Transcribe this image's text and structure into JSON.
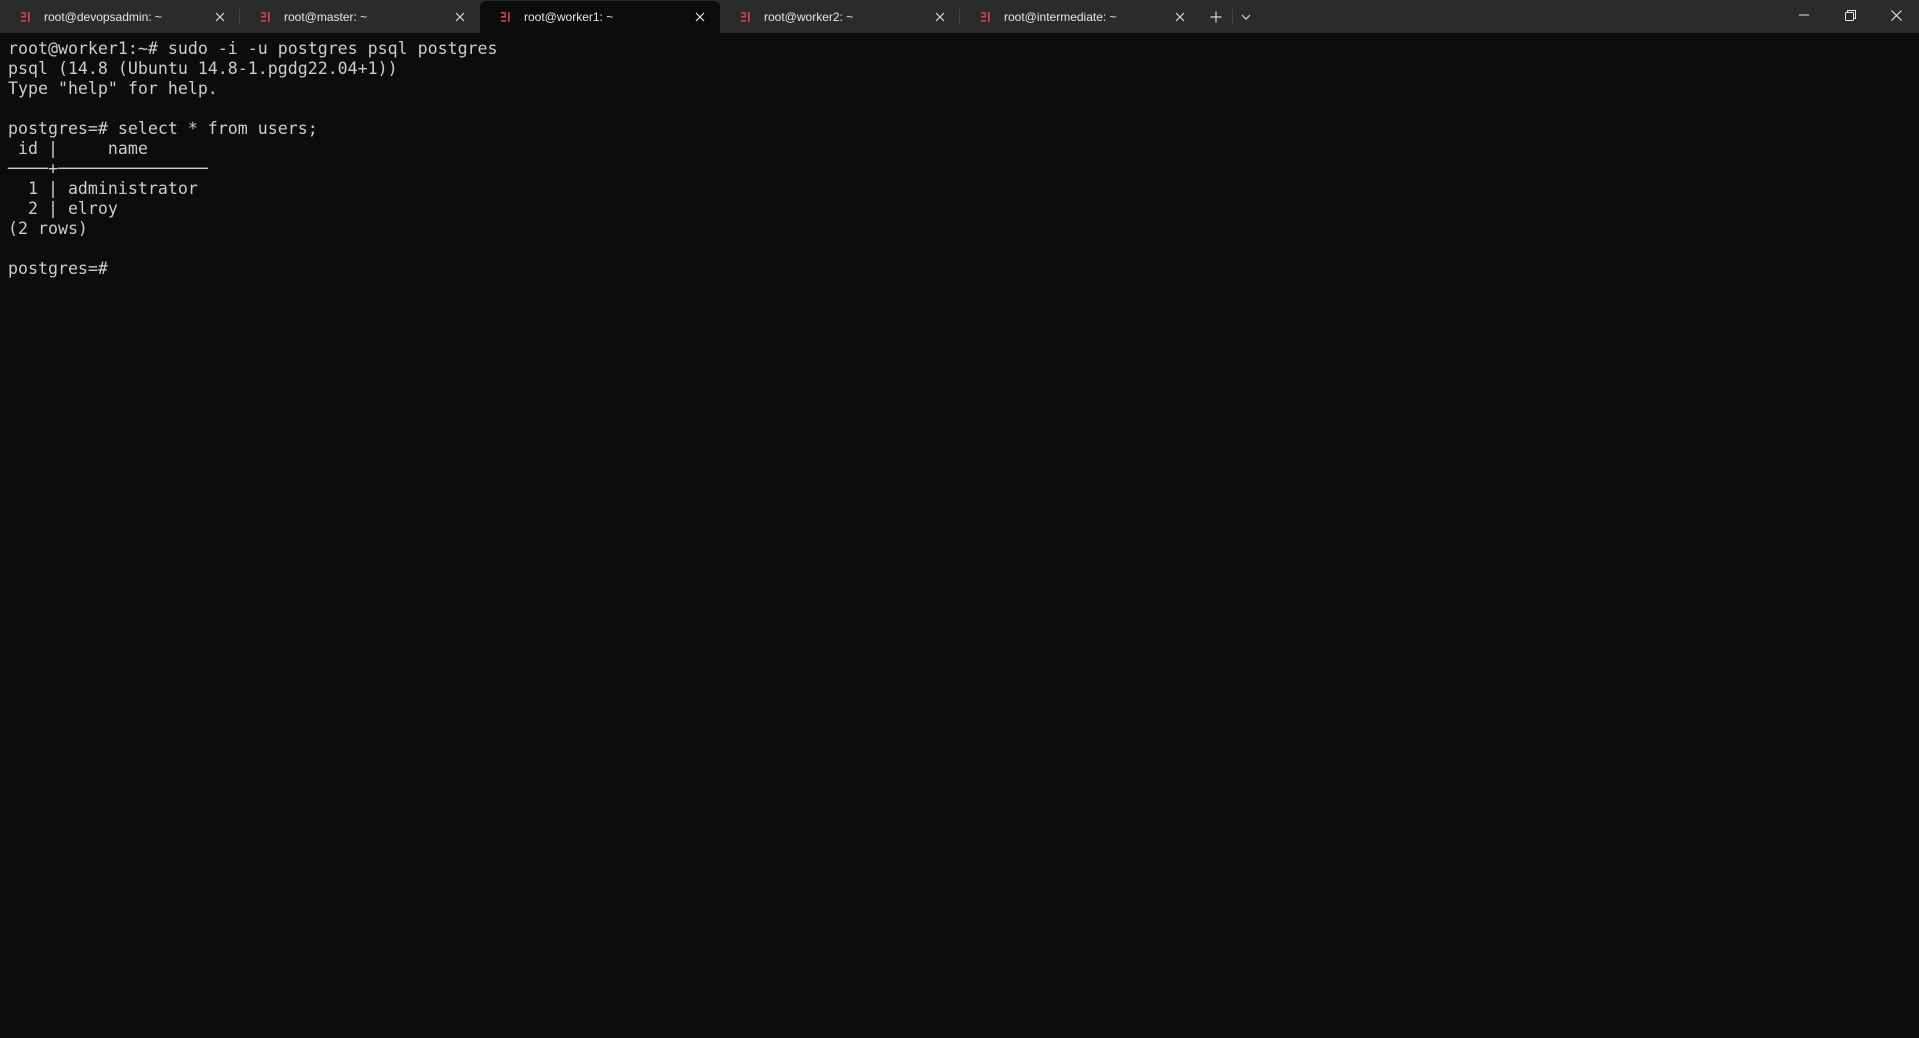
{
  "tabs": [
    {
      "title": "root@devopsadmin: ~",
      "active": false
    },
    {
      "title": "root@master: ~",
      "active": false
    },
    {
      "title": "root@worker1: ~",
      "active": true
    },
    {
      "title": "root@worker2: ~",
      "active": false
    },
    {
      "title": "root@intermediate: ~",
      "active": false
    }
  ],
  "icons": {
    "tab_icon": "ubuntu-shell-icon",
    "tab_close": "close-icon",
    "new_tab": "plus-icon",
    "dropdown": "chevron-down-icon",
    "minimize": "minimize-icon",
    "maximize": "restore-icon",
    "close_window": "close-window-icon"
  },
  "colors": {
    "tab_icon": "#e0403a",
    "terminal_bg": "#0c0c0c",
    "terminal_fg": "#cccccc",
    "titlebar_bg": "#2b2b2b"
  },
  "terminal": {
    "lines": [
      "root@worker1:~# sudo -i -u postgres psql postgres",
      "psql (14.8 (Ubuntu 14.8-1.pgdg22.04+1))",
      "Type \"help\" for help.",
      "",
      "postgres=# select * from users;",
      " id |     name",
      "────+───────────────",
      "  1 | administrator",
      "  2 | elroy",
      "(2 rows)",
      "",
      "postgres=# "
    ]
  }
}
